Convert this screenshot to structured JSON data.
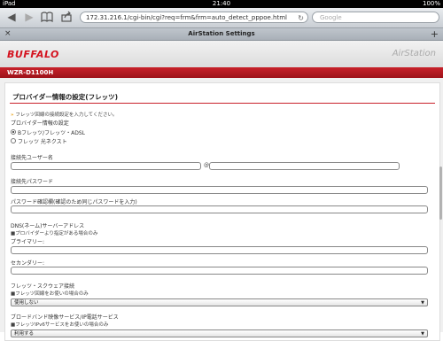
{
  "statusbar": {
    "carrier": "iPad",
    "time": "21:40",
    "battery": "100%"
  },
  "toolbar": {
    "url": "172.31.216.1/cgi-bin/cgi?req=frm&frm=auto_detect_pppoe.html",
    "search_placeholder": "Google",
    "icons": [
      "back-icon",
      "forward-icon",
      "bookmarks-icon",
      "share-icon",
      "reload-icon"
    ]
  },
  "tab": {
    "title": "AirStation Settings",
    "close": "×",
    "plus": "+"
  },
  "header": {
    "logo": "BUFFALO",
    "product": "AirStation",
    "model": "WZR-D1100H"
  },
  "panel": {
    "title": "プロバイダー情報の設定(フレッツ)",
    "intro": "フレッツ回線の接続設定を入力してください。",
    "provider_label": "プロバイダー情報の設定",
    "radio_options": [
      {
        "label": "Bフレッツ/フレッツ・ADSL",
        "checked": true
      },
      {
        "label": "フレッツ 光ネクスト",
        "checked": false
      }
    ],
    "username_label": "接続先ユーザー名",
    "at_sign": "@",
    "password_label": "接続先パスワード",
    "password_confirm_label": "パスワード確認欄(確認のため同じパスワードを入力)",
    "dns_label": "DNS(ネーム)サーバーアドレス",
    "dns_note": "■プロバイダーより指定がある場合のみ",
    "primary_label": "プライマリー:",
    "secondary_label": "セカンダリー:",
    "square_label": "フレッツ・スクウェア接続",
    "square_note": "■フレッツ回線をお使いの場合のみ",
    "square_select": "使用しない",
    "broadband_label": "ブロードバンド映像サービス/IP電話サービス",
    "broadband_note": "■フレッツIPv6サービスをお使いの場合のみ",
    "broadband_select": "利用する"
  }
}
